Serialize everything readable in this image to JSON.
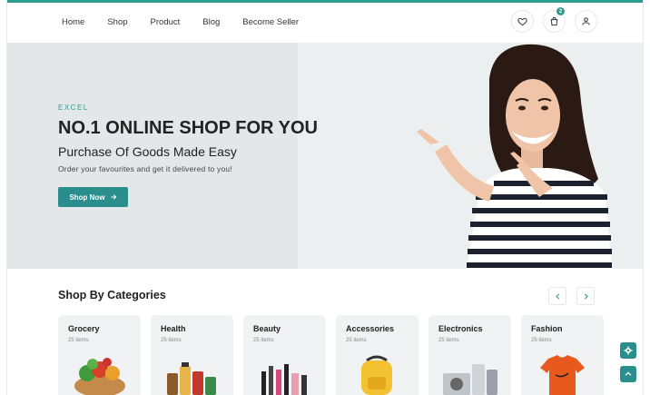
{
  "nav": {
    "links": [
      "Home",
      "Shop",
      "Product",
      "Blog",
      "Become Seller"
    ],
    "cart_count": "2",
    "icons": [
      "heart-icon",
      "shopping-bag-icon",
      "user-icon"
    ]
  },
  "hero": {
    "kicker": "EXCEL",
    "title": "NO.1 ONLINE SHOP FOR YOU",
    "subtitle": "Purchase Of Goods Made Easy",
    "description": "Order your favourites and get it delivered to you!",
    "button_label": "Shop Now",
    "button_icon": "arrow-right-icon"
  },
  "categories": {
    "title": "Shop By Categories",
    "items": [
      {
        "name": "Grocery",
        "count": "25 items"
      },
      {
        "name": "Health",
        "count": "25 items"
      },
      {
        "name": "Beauty",
        "count": "25 items"
      },
      {
        "name": "Accessories",
        "count": "25 items"
      },
      {
        "name": "Electronics",
        "count": "25 items"
      },
      {
        "name": "Fashion",
        "count": "25 items"
      }
    ]
  },
  "colors": {
    "accent": "#2a9d8f",
    "button": "#2a8f8c",
    "hero_bg": "#e3e7e8"
  }
}
